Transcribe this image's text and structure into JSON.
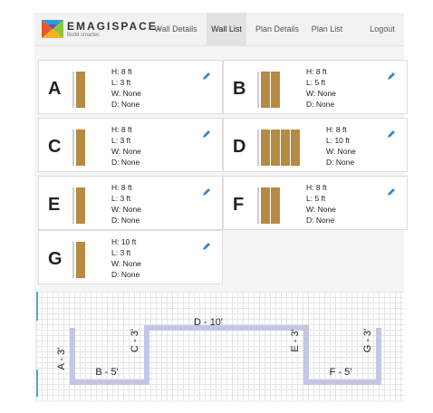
{
  "app": {
    "brand": "EMAGISPACE.",
    "tagline": "Build smarter."
  },
  "nav": [
    {
      "label": "Wall Details",
      "active": false
    },
    {
      "label": "Wall List",
      "active": true
    },
    {
      "label": "Plan Details",
      "active": false
    },
    {
      "label": "Plan List",
      "active": false
    },
    {
      "label": "Logout",
      "active": false
    }
  ],
  "walls": [
    {
      "letter": "A",
      "height": "H: 8 ft",
      "length": "L: 3 ft",
      "windows": "W: None",
      "doors": "D: None"
    },
    {
      "letter": "B",
      "height": "H: 8 ft",
      "length": "L: 5 ft",
      "windows": "W: None",
      "doors": "D: None"
    },
    {
      "letter": "C",
      "height": "H: 8 ft",
      "length": "L: 3 ft",
      "windows": "W: None",
      "doors": "D: None"
    },
    {
      "letter": "D",
      "height": "H: 8 ft",
      "length": "L: 10 ft",
      "windows": "W: None",
      "doors": "D: None"
    },
    {
      "letter": "E",
      "height": "H: 8 ft",
      "length": "L: 3 ft",
      "windows": "W: None",
      "doors": "D: None"
    },
    {
      "letter": "F",
      "height": "H: 8 ft",
      "length": "L: 5 ft",
      "windows": "W: None",
      "doors": "D: None"
    },
    {
      "letter": "G",
      "height": "H: 10 ft",
      "length": "L: 3 ft",
      "windows": "W: None",
      "doors": "D: None"
    }
  ],
  "plan": {
    "labels": [
      "A - 3'",
      "B - 5'",
      "C - 3'",
      "D - 10'",
      "E - 3'",
      "F - 5'",
      "G - 3'"
    ]
  },
  "colors": {
    "panel": "#b58a43",
    "wall": "#c5c6e6",
    "accent": "#5ba3c6",
    "edit": "#3a86c8"
  },
  "icons": {
    "edit": "pencil-icon",
    "logo": "emagispace-logo"
  }
}
